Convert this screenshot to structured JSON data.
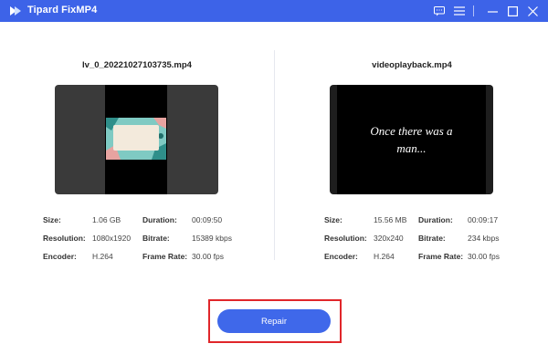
{
  "app": {
    "title": "Tipard FixMP4",
    "accent_color": "#3d63e8",
    "window_controls": [
      "chat-icon",
      "menu-icon",
      "minimize-icon",
      "maximize-icon",
      "close-icon"
    ]
  },
  "left": {
    "file_name": "lv_0_20221027103735.mp4",
    "size_label": "Size:",
    "size_value": "1.06 GB",
    "duration_label": "Duration:",
    "duration_value": "00:09:50",
    "resolution_label": "Resolution:",
    "resolution_value": "1080x1920",
    "bitrate_label": "Bitrate:",
    "bitrate_value": "15389 kbps",
    "encoder_label": "Encoder:",
    "encoder_value": "H.264",
    "framerate_label": "Frame Rate:",
    "framerate_value": "30.00 fps"
  },
  "right": {
    "file_name": "videoplayback.mp4",
    "caption_line1": "Once there was a",
    "caption_line2": "man...",
    "size_label": "Size:",
    "size_value": "15.56 MB",
    "duration_label": "Duration:",
    "duration_value": "00:09:17",
    "resolution_label": "Resolution:",
    "resolution_value": "320x240",
    "bitrate_label": "Bitrate:",
    "bitrate_value": "234 kbps",
    "encoder_label": "Encoder:",
    "encoder_value": "H.264",
    "framerate_label": "Frame Rate:",
    "framerate_value": "30.00 fps"
  },
  "repair": {
    "label": "Repair",
    "highlight_color": "#e0262a"
  }
}
